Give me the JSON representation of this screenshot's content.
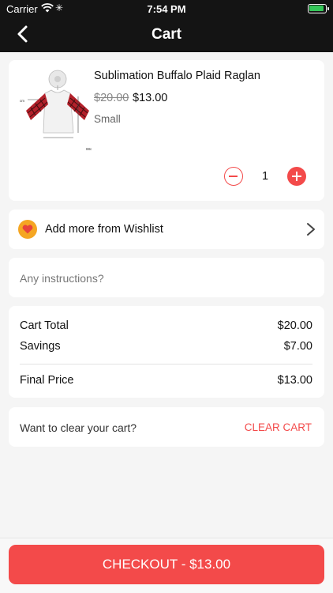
{
  "status_bar": {
    "carrier": "Carrier",
    "time": "7:54 PM"
  },
  "nav": {
    "title": "Cart",
    "back_icon": "chevron-left-icon"
  },
  "cart_item": {
    "name": "Sublimation Buffalo Plaid Raglan",
    "original_price": "$20.00",
    "price": "$13.00",
    "size": "Small",
    "quantity": "1"
  },
  "wishlist": {
    "label": "Add more from Wishlist",
    "icon": "heart-icon"
  },
  "instructions": {
    "placeholder": "Any instructions?",
    "value": ""
  },
  "summary": {
    "cart_total_label": "Cart Total",
    "cart_total_value": "$20.00",
    "savings_label": "Savings",
    "savings_value": "$7.00",
    "final_label": "Final Price",
    "final_value": "$13.00"
  },
  "clear": {
    "question": "Want to clear your cart?",
    "button": "CLEAR CART"
  },
  "checkout": {
    "label": "CHECKOUT - $13.00"
  },
  "colors": {
    "accent": "#f34a4a",
    "nav_bg": "#141414",
    "heart_bg": "#f5a623"
  }
}
